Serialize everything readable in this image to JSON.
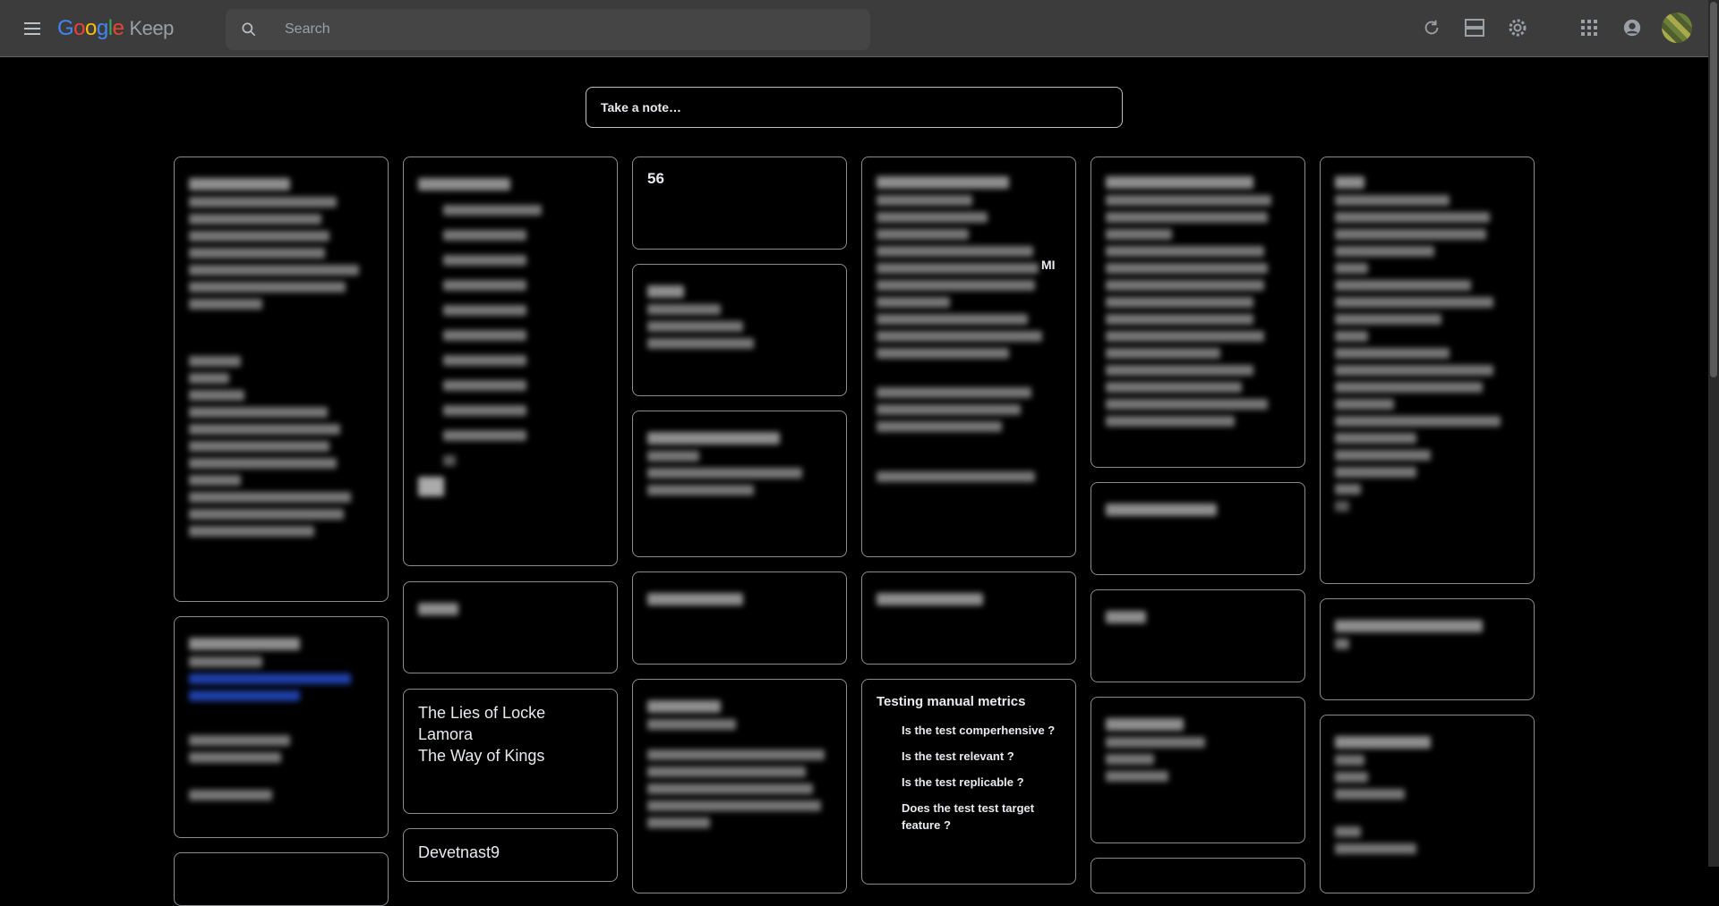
{
  "app": {
    "logo_letters": [
      "G",
      "o",
      "o",
      "g",
      "l",
      "e"
    ],
    "product": "Keep"
  },
  "search": {
    "placeholder": "Search"
  },
  "toolbar": {
    "icons": [
      "menu-icon",
      "search-icon",
      "refresh-icon",
      "list-view-icon",
      "settings-icon",
      "apps-icon",
      "account-icon"
    ]
  },
  "take_note": {
    "placeholder": "Take a note…"
  },
  "notes": {
    "n56": {
      "title": "56"
    },
    "lies": {
      "line1": "The Lies of Locke",
      "line2": "Lamora",
      "line3": "The Way of Kings"
    },
    "devet": {
      "title": "Devetnast9"
    },
    "testing": {
      "title": "Testing manual metrics",
      "items": [
        "Is the test comperhensive ?",
        "Is the test relevant ?",
        "Is the test replicable ?",
        "Does the test test target feature ?"
      ]
    },
    "mi_fragment": "MI"
  },
  "colors": {
    "topbar": "#3c3c3c",
    "background": "#000000",
    "note_border": "#8a8d90"
  }
}
